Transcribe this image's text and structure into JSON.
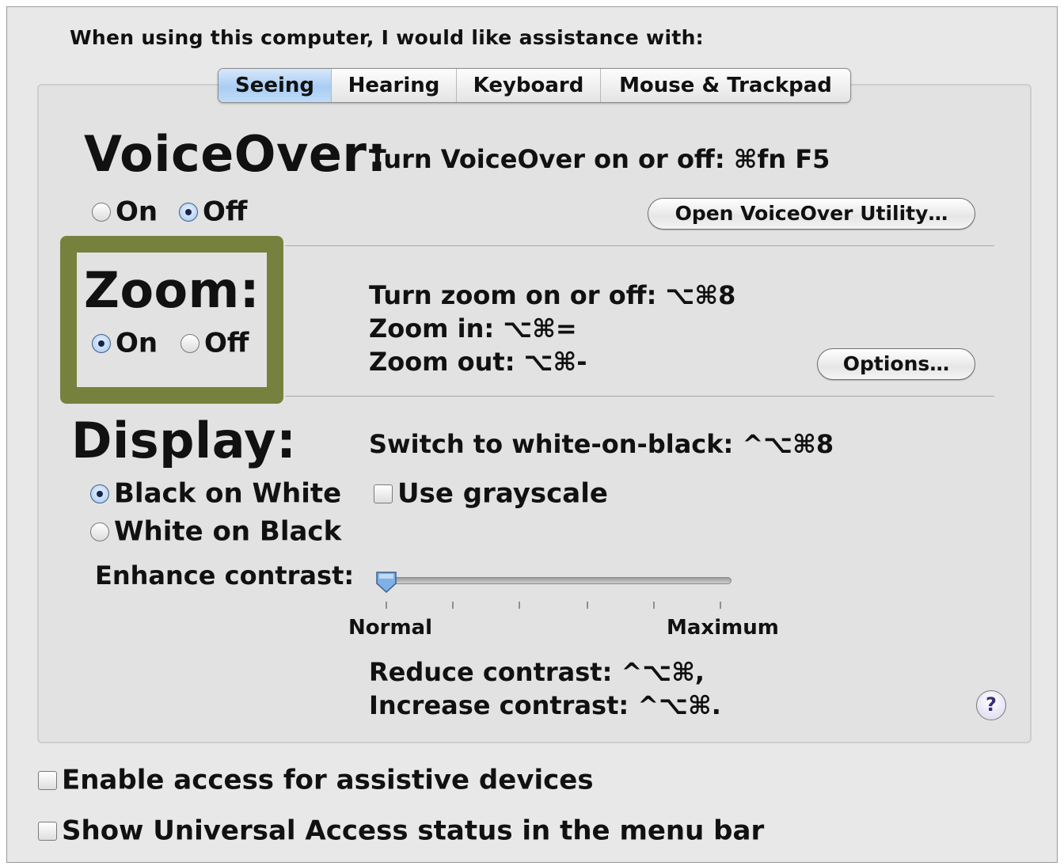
{
  "prompt": "When using this computer, I would like assistance with:",
  "tabs": [
    {
      "label": "Seeing",
      "active": true
    },
    {
      "label": "Hearing",
      "active": false
    },
    {
      "label": "Keyboard",
      "active": false
    },
    {
      "label": "Mouse & Trackpad",
      "active": false
    }
  ],
  "voiceover": {
    "title": "VoiceOver:",
    "shortcut": "Turn VoiceOver on or off: ⌘fn F5",
    "on_label": "On",
    "off_label": "Off",
    "selected": "Off",
    "button_label": "Open VoiceOver Utility…"
  },
  "zoom": {
    "title": "Zoom:",
    "on_label": "On",
    "off_label": "Off",
    "selected": "On",
    "shortcut_toggle": "Turn zoom on or off: ⌥⌘8",
    "shortcut_in": "Zoom in: ⌥⌘=",
    "shortcut_out": "Zoom out: ⌥⌘-",
    "options_label": "Options…",
    "highlight_color": "#76813d"
  },
  "display": {
    "title": "Display:",
    "shortcut": "Switch to white-on-black: ^⌥⌘8",
    "black_on_white": "Black on White",
    "white_on_black": "White on Black",
    "selected": "Black on White",
    "grayscale_label": "Use grayscale",
    "grayscale_checked": false,
    "contrast_label": "Enhance contrast:",
    "contrast_min_label": "Normal",
    "contrast_max_label": "Maximum",
    "contrast_value": 0,
    "reduce_contrast": "Reduce contrast: ^⌥⌘,",
    "increase_contrast": "Increase contrast: ^⌥⌘."
  },
  "help_label": "?",
  "footer": {
    "assistive_label": "Enable access for assistive devices",
    "assistive_checked": false,
    "status_label": "Show Universal Access status in the menu bar",
    "status_checked": false
  },
  "colors": {
    "active_tab": "#a9cdf3",
    "window_bg": "#e8e8e8"
  }
}
